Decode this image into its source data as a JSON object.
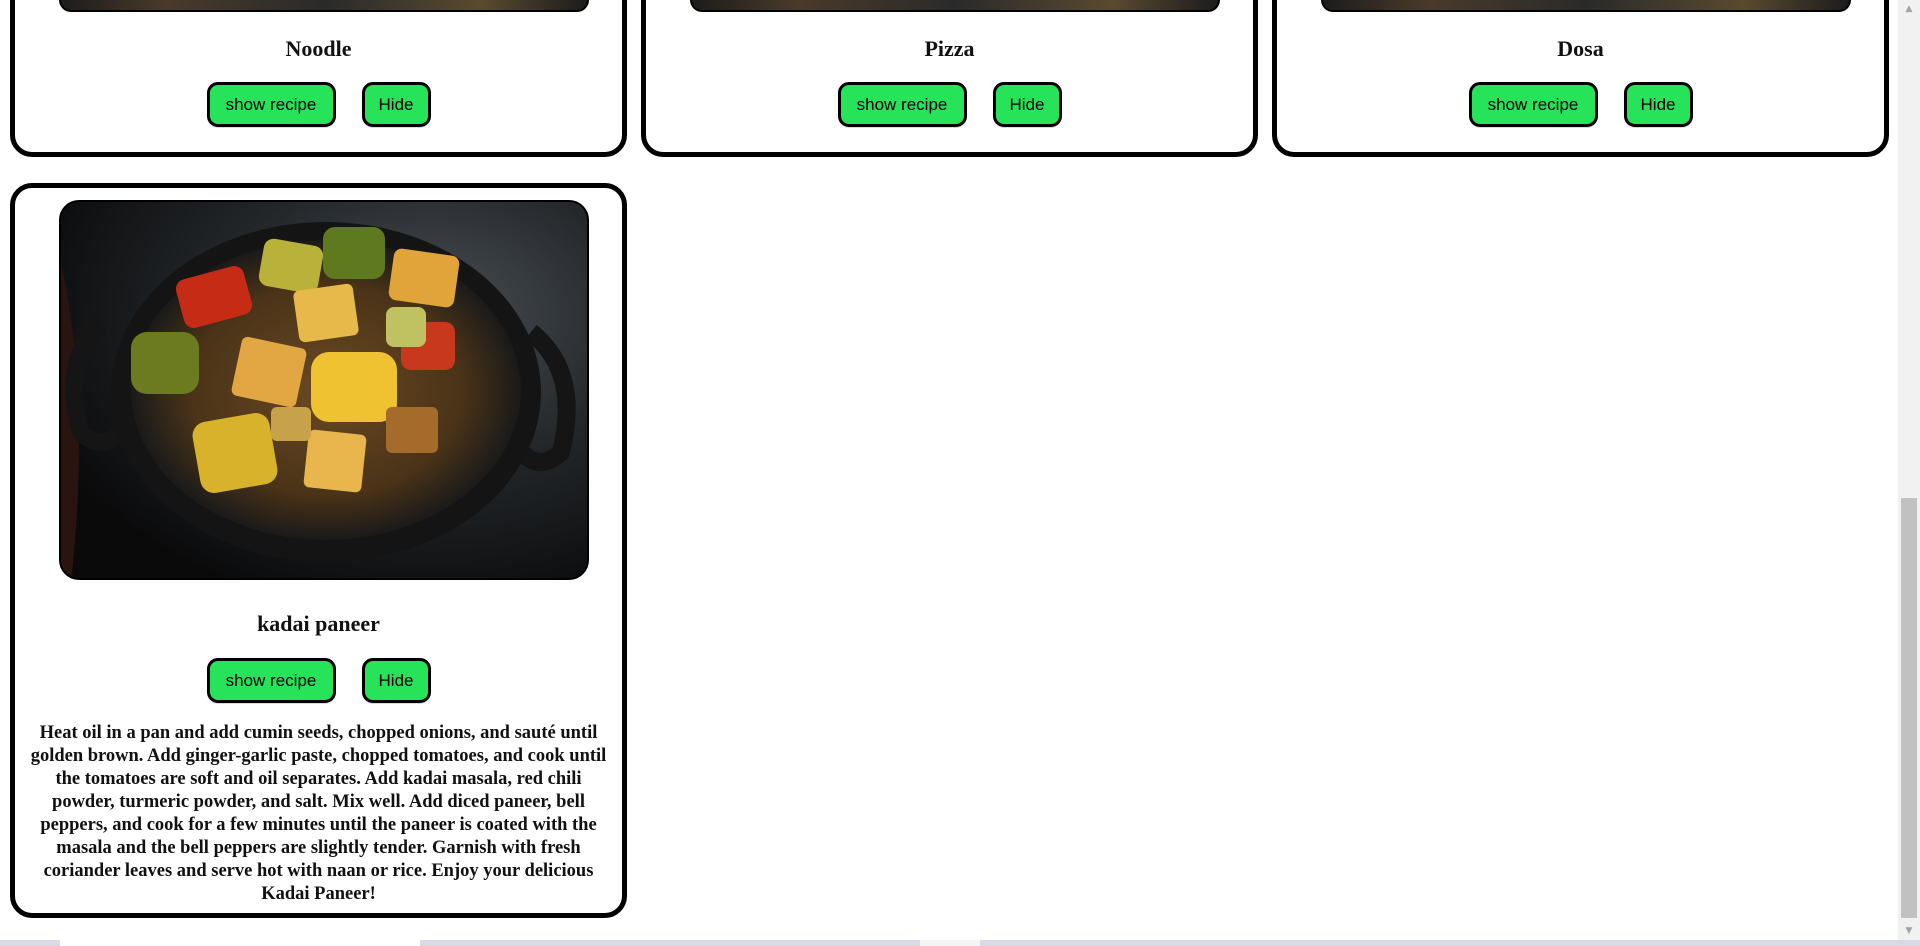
{
  "cards": [
    {
      "title": "Noodle",
      "show_label": "show recipe",
      "hide_label": "Hide"
    },
    {
      "title": "Pizza",
      "show_label": "show recipe",
      "hide_label": "Hide"
    },
    {
      "title": "Dosa",
      "show_label": "show recipe",
      "hide_label": "Hide"
    },
    {
      "title": "kadai paneer",
      "show_label": "show recipe",
      "hide_label": "Hide",
      "recipe": "Heat oil in a pan and add cumin seeds, chopped onions, and sauté until golden brown. Add ginger-garlic paste, chopped tomatoes, and cook until the tomatoes are soft and oil separates. Add kadai masala, red chili powder, turmeric powder, and salt. Mix well. Add diced paneer, bell peppers, and cook for a few minutes until the paneer is coated with the masala and the bell peppers are slightly tender. Garnish with fresh coriander leaves and serve hot with naan or rice. Enjoy your delicious Kadai Paneer!"
    }
  ],
  "colors": {
    "button_bg": "#27e35a",
    "border": "#000000"
  },
  "icons": {
    "scroll_up": "triangle-up-icon",
    "scroll_down": "triangle-down-icon"
  }
}
